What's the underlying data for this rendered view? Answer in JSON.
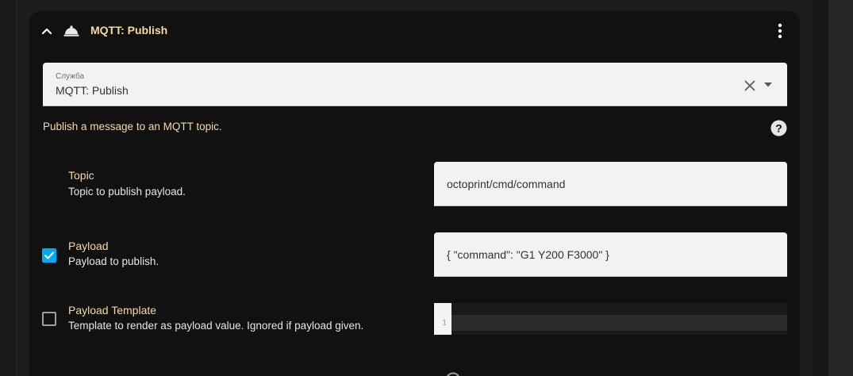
{
  "header": {
    "title": "MQTT: Publish"
  },
  "service": {
    "label": "Служба",
    "value": "MQTT: Publish"
  },
  "description": "Publish a message to an MQTT topic.",
  "fields": [
    {
      "name": "Topic",
      "description": "Topic to publish payload.",
      "value": "octoprint/cmd/command"
    },
    {
      "name": "Payload",
      "description": "Payload to publish.",
      "value": "{ \"command\": \"G1 Y200 F3000\" }",
      "enabled": true
    },
    {
      "name": "Payload Template",
      "description": "Template to render as payload value. Ignored if payload given.",
      "enabled": false,
      "line_number": "1"
    }
  ],
  "colors": {
    "accent": "#f8d9a4",
    "checkbox_checked": "#03a9f4",
    "card_background": "#111111",
    "field_background": "#f2f2f2"
  },
  "icons": [
    "chevron-up-icon",
    "bell-service-icon",
    "more-vertical-icon",
    "close-icon",
    "dropdown-arrow-icon",
    "help-circle-icon",
    "checkmark-icon"
  ]
}
